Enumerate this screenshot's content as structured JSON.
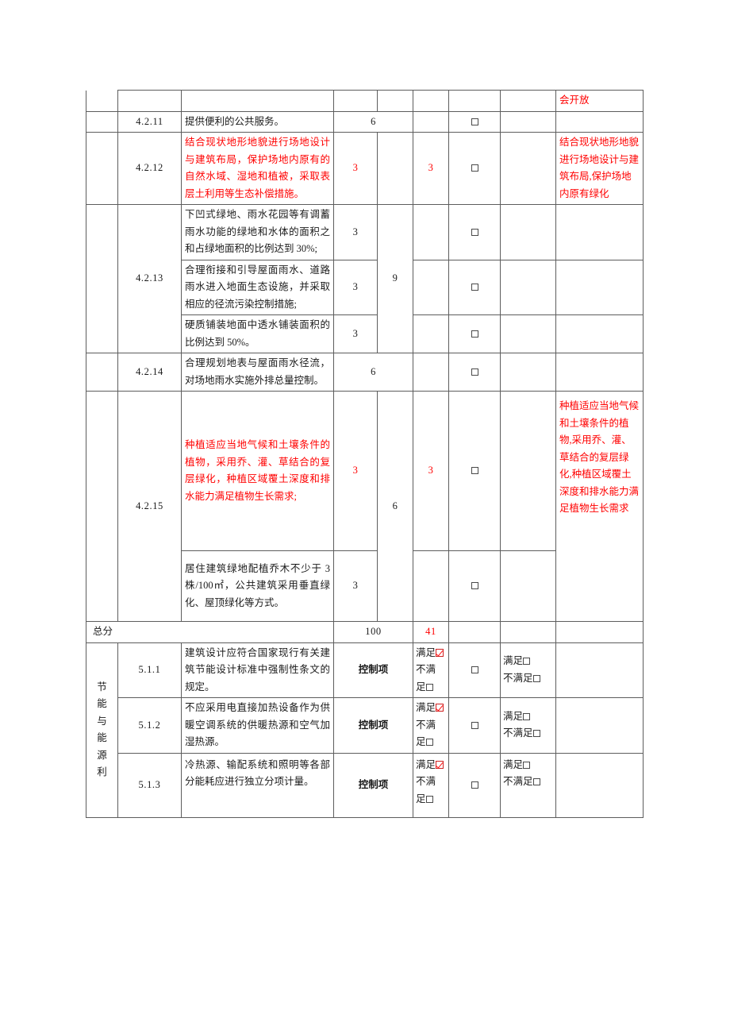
{
  "colors": {
    "red": "#ff0000",
    "text": "#1a1a1a",
    "border": "#5d5d5d"
  },
  "top_partial_row": {
    "note": "会开放"
  },
  "rows": [
    {
      "num": "4.2.11",
      "desc": "提供便利的公共服务。",
      "score": "6",
      "self": "",
      "note": ""
    },
    {
      "num": "4.2.12",
      "desc": "结合现状地形地貌进行场地设计与建筑布局，保护场地内原有的自然水域、湿地和植被，采取表层土利用等生态补偿措施。",
      "score": "3",
      "self": "3",
      "note": "结合现状地形地貌进行场地设计与建筑布局,保护场地内原有绿化"
    },
    {
      "num": "4.2.13",
      "subtotal": "9",
      "sub_rows": [
        {
          "desc": "下凹式绿地、雨水花园等有调蓄雨水功能的绿地和水体的面积之和占绿地面积的比例达到 30%;",
          "score": "3"
        },
        {
          "desc": "合理衔接和引导屋面雨水、道路雨水进入地面生态设施，并采取相应的径流污染控制措施;",
          "score": "3"
        },
        {
          "desc": "硬质铺装地面中透水铺装面积的比例达到 50%。",
          "score": "3"
        }
      ]
    },
    {
      "num": "4.2.14",
      "desc": "合理规划地表与屋面雨水径流，对场地雨水实施外排总量控制。",
      "score": "6",
      "self": "",
      "note": ""
    },
    {
      "num": "4.2.15",
      "subtotal": "6",
      "note": "种植适应当地气候和土壤条件的植物,采用乔、灌、草结合的复层绿化,种植区域覆土深度和排水能力满足植物生长需求",
      "sub_rows": [
        {
          "desc": "种植适应当地气候和土壤条件的植物，采用乔、灌、草结合的复层绿化，种植区域覆土深度和排水能力满足植物生长需求;",
          "score": "3",
          "self": "3"
        },
        {
          "desc": "居住建筑绿地配植乔木不少于 3 株/100㎡，公共建筑采用垂直绿化、屋顶绿化等方式。",
          "score": "3",
          "self": ""
        }
      ]
    }
  ],
  "total_row": {
    "label": "总分",
    "score": "100",
    "self": "41"
  },
  "section2": {
    "category_chars": [
      "节",
      "能",
      "与",
      "能",
      "源",
      "利"
    ],
    "control_label": "控制项",
    "satisfy_label": "满足",
    "not_satisfy_label": "不满足",
    "rows": [
      {
        "num": "5.1.1",
        "desc": "建筑设计应符合国家现行有关建筑节能设计标准中强制性条文的规定。",
        "score_label": "控制项",
        "self_satisfy_checked": true,
        "self_not_satisfy_checked": false,
        "review_satisfy_checked": false,
        "review_not_satisfy_checked": false,
        "note": ""
      },
      {
        "num": "5.1.2",
        "desc": "不应采用电直接加热设备作为供暖空调系统的供暖热源和空气加湿热源。",
        "score_label": "控制项",
        "self_satisfy_checked": true,
        "self_not_satisfy_checked": false,
        "review_satisfy_checked": false,
        "review_not_satisfy_checked": false,
        "note": ""
      },
      {
        "num": "5.1.3",
        "desc": "冷热源、输配系统和照明等各部分能耗应进行独立分项计量。",
        "score_label": "控制项",
        "self_satisfy_checked": true,
        "self_not_satisfy_checked": false,
        "review_satisfy_checked": false,
        "review_not_satisfy_checked": false,
        "note": ""
      }
    ]
  }
}
